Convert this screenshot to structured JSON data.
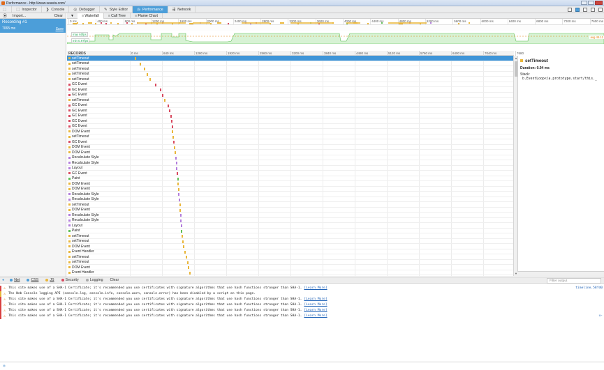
{
  "window": {
    "title": "Performance - http://www.seasta.com/"
  },
  "toolbar": {
    "tabs": [
      {
        "label": "Inspector",
        "icon": "inspector-icon",
        "glyph": "⬚"
      },
      {
        "label": "Console",
        "icon": "console-icon",
        "glyph": "❯"
      },
      {
        "label": "Debugger",
        "icon": "debugger-icon",
        "glyph": "◎"
      },
      {
        "label": "Style Editor",
        "icon": "style-editor-icon",
        "glyph": "✎"
      },
      {
        "label": "Performance",
        "icon": "performance-icon",
        "glyph": "◷",
        "selected": true
      },
      {
        "label": "Network",
        "icon": "network-icon",
        "glyph": "⇶"
      }
    ]
  },
  "recordings": {
    "import_label": "Import...",
    "clear_label": "Clear",
    "items": [
      {
        "name": "Recording #1",
        "duration": "7065 ms",
        "save_label": "Save"
      }
    ]
  },
  "perf_tabs": [
    {
      "label": "Waterfall",
      "icon": "waterfall-icon",
      "selected": true
    },
    {
      "label": "Call Tree",
      "icon": "call-tree-icon"
    },
    {
      "label": "Flame Chart",
      "icon": "flame-chart-icon"
    }
  ],
  "overview_ticks": [
    "0 ms",
    "400 ms",
    "800 ms",
    "1200 ms",
    "1600 ms",
    "2000 ms",
    "2400 ms",
    "2800 ms",
    "3200 ms",
    "3600 ms",
    "4000 ms",
    "4400 ms",
    "4800 ms",
    "5200 ms",
    "5600 ms",
    "6000 ms",
    "6400 ms",
    "6800 ms",
    "7200 ms",
    "7600 ms"
  ],
  "fps": {
    "max_label": "max 60fps",
    "min_label": "min 0.97fps",
    "avg_label": "avg 45.11"
  },
  "records": {
    "header": "RECORDS",
    "ticks": [
      "0 ms",
      "640 ms",
      "1280 ms",
      "1920 ms",
      "2560 ms",
      "3200 ms",
      "3840 ms",
      "4480 ms",
      "5120 ms",
      "5760 ms",
      "6400 ms",
      "7040 ms",
      "7680"
    ],
    "rows": [
      {
        "name": "setTimeout",
        "kind": "js"
      },
      {
        "name": "setTimeout",
        "kind": "js"
      },
      {
        "name": "setTimeout",
        "kind": "js"
      },
      {
        "name": "setTimeout",
        "kind": "js"
      },
      {
        "name": "setTimeout",
        "kind": "js"
      },
      {
        "name": "GC Event",
        "kind": "gc"
      },
      {
        "name": "GC Event",
        "kind": "gc"
      },
      {
        "name": "GC Event",
        "kind": "gc"
      },
      {
        "name": "setTimeout",
        "kind": "js"
      },
      {
        "name": "GC Event",
        "kind": "gc"
      },
      {
        "name": "GC Event",
        "kind": "gc"
      },
      {
        "name": "GC Event",
        "kind": "gc"
      },
      {
        "name": "GC Event",
        "kind": "gc"
      },
      {
        "name": "GC Event",
        "kind": "gc"
      },
      {
        "name": "DOM Event",
        "kind": "js"
      },
      {
        "name": "setTimeout",
        "kind": "js"
      },
      {
        "name": "GC Event",
        "kind": "gc"
      },
      {
        "name": "DOM Event",
        "kind": "js"
      },
      {
        "name": "DOM Event",
        "kind": "js"
      },
      {
        "name": "Recalculate Style",
        "kind": "style"
      },
      {
        "name": "Recalculate Style",
        "kind": "style"
      },
      {
        "name": "Layout",
        "kind": "style"
      },
      {
        "name": "GC Event",
        "kind": "gc"
      },
      {
        "name": "Paint",
        "kind": "paint"
      },
      {
        "name": "DOM Event",
        "kind": "js"
      },
      {
        "name": "DOM Event",
        "kind": "js"
      },
      {
        "name": "Recalculate Style",
        "kind": "style"
      },
      {
        "name": "Recalculate Style",
        "kind": "style"
      },
      {
        "name": "setTimeout",
        "kind": "js"
      },
      {
        "name": "DOM Event",
        "kind": "js"
      },
      {
        "name": "Recalculate Style",
        "kind": "style"
      },
      {
        "name": "Recalculate Style",
        "kind": "style"
      },
      {
        "name": "Layout",
        "kind": "style"
      },
      {
        "name": "Paint",
        "kind": "paint"
      },
      {
        "name": "setTimeout",
        "kind": "js"
      },
      {
        "name": "setTimeout",
        "kind": "js"
      },
      {
        "name": "DOM Event",
        "kind": "js"
      },
      {
        "name": "Event Handler",
        "kind": "js"
      },
      {
        "name": "setTimeout",
        "kind": "js"
      },
      {
        "name": "setTimeout",
        "kind": "js"
      },
      {
        "name": "DOM Event",
        "kind": "js"
      },
      {
        "name": "Event Handler",
        "kind": "js"
      }
    ]
  },
  "colors": {
    "js": "#e9b63a",
    "gc": "#d84a60",
    "style": "#b37edc",
    "paint": "#5fbf57",
    "accent": "#4c9ed9"
  },
  "details": {
    "title": "setTimeout",
    "duration": "Duration: 0.04 ms",
    "stack_label": "Stack:",
    "stack_value": "b.EventLoop</a.prototype.start/this._"
  },
  "console_filters": [
    {
      "label": "Net",
      "dot": "#4c9ed9",
      "underline": true
    },
    {
      "label": "CSS",
      "dot": "#4c9ed9",
      "underline": true
    },
    {
      "label": "JS",
      "dot": "#e9b63a",
      "underline": true
    },
    {
      "label": "Security",
      "dot": "#d84a60"
    },
    {
      "label": "Logging",
      "dot": "#aaaaaa"
    },
    {
      "label": "Clear"
    }
  ],
  "filter_placeholder": "Filter output",
  "console_messages": [
    {
      "text": "This site makes use of a SHA-1 Certificate; it's recommended you use certificates with signature algorithms that use hash functions stronger than SHA-1.",
      "link": "[Learn More]",
      "source": "timeline.58fd0"
    },
    {
      "text": "The Web Console logging API (console.log, console.info, console.warn, console.error) has been disabled by a script on this page.",
      "link": "",
      "source": ""
    },
    {
      "text": "This site makes use of a SHA-1 Certificate; it's recommended you use certificates with signature algorithms that use hash functions stronger than SHA-1.",
      "link": "[Learn More]",
      "source": ""
    },
    {
      "text": "This site makes use of a SHA-1 Certificate; it's recommended you use certificates with signature algorithms that use hash functions stronger than SHA-1.",
      "link": "[Learn More]",
      "source": ""
    },
    {
      "text": "This site makes use of a SHA-1 Certificate; it's recommended you use certificates with signature algorithms that use hash functions stronger than SHA-1.",
      "link": "[Learn More]",
      "source": ""
    },
    {
      "text": "This site makes use of a SHA-1 Certificate; it's recommended you use certificates with signature algorithms that use hash functions stronger than SHA-1.",
      "link": "[Learn More]",
      "source": "u-"
    }
  ],
  "prompt_glyph": "»"
}
